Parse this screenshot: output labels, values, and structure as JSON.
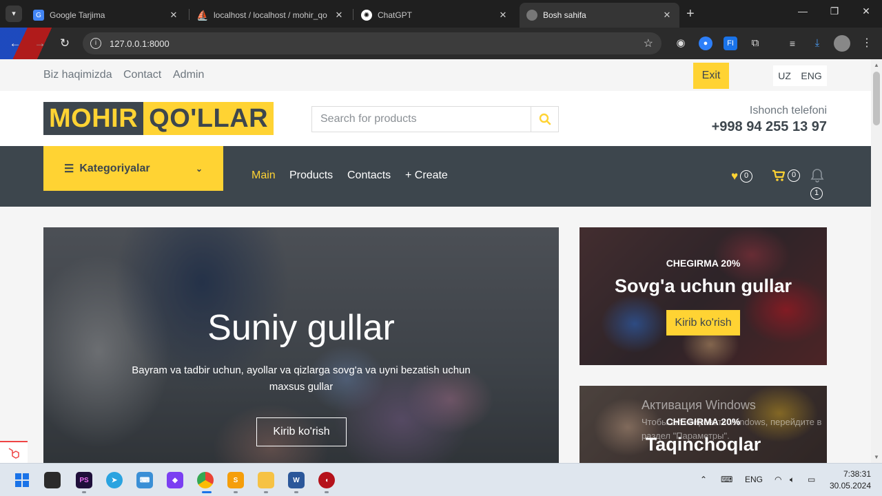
{
  "browser": {
    "tabs": [
      {
        "title": "Google Tarjima",
        "favicon": "google-translate-icon",
        "active": false
      },
      {
        "title": "localhost / localhost / mohir_qo",
        "favicon": "phpmyadmin-icon",
        "active": false
      },
      {
        "title": "ChatGPT",
        "favicon": "chatgpt-icon",
        "active": false
      },
      {
        "title": "Bosh sahifa",
        "favicon": "globe-icon",
        "active": true
      }
    ],
    "url": "127.0.0.1:8000"
  },
  "topbar": {
    "links": [
      "Biz haqimizda",
      "Contact",
      "Admin"
    ],
    "exit_label": "Exit",
    "lang_uz": "UZ",
    "lang_eng": "ENG"
  },
  "header": {
    "logo_part1": "MOHIR",
    "logo_part2": "QO'LLAR",
    "search_placeholder": "Search for products",
    "trust_label": "Ishonch telefoni",
    "trust_phone": "+998 94 255 13 97"
  },
  "navbar": {
    "categories_label": "Kategoriyalar",
    "links": [
      "Main",
      "Products",
      "Contacts",
      "+ Create"
    ],
    "active_link": "Main",
    "wishlist_count": "0",
    "cart_count": "0",
    "notification_count": "1"
  },
  "hero": {
    "title": "Suniy gullar",
    "description": "Bayram va tadbir uchun, ayollar va qizlarga sovg'a va uyni bezatish uchun maxsus gullar",
    "button": "Kirib ko'rish"
  },
  "offers": [
    {
      "subtitle": "CHEGIRMA 20%",
      "title": "Sovg'a uchun gullar",
      "button": "Kirib ko'rish"
    },
    {
      "subtitle": "CHEGIRMA 20%",
      "title": "Taqinchoqlar"
    }
  ],
  "watermark": {
    "title": "Активация Windows",
    "text": "Чтобы активировать Windows, перейдите в раздел \"Параметры\"."
  },
  "taskbar": {
    "lang": "ENG",
    "time": "7:38:31",
    "date": "30.05.2024"
  },
  "colors": {
    "accent": "#FFD333",
    "dark": "#3D464D"
  }
}
